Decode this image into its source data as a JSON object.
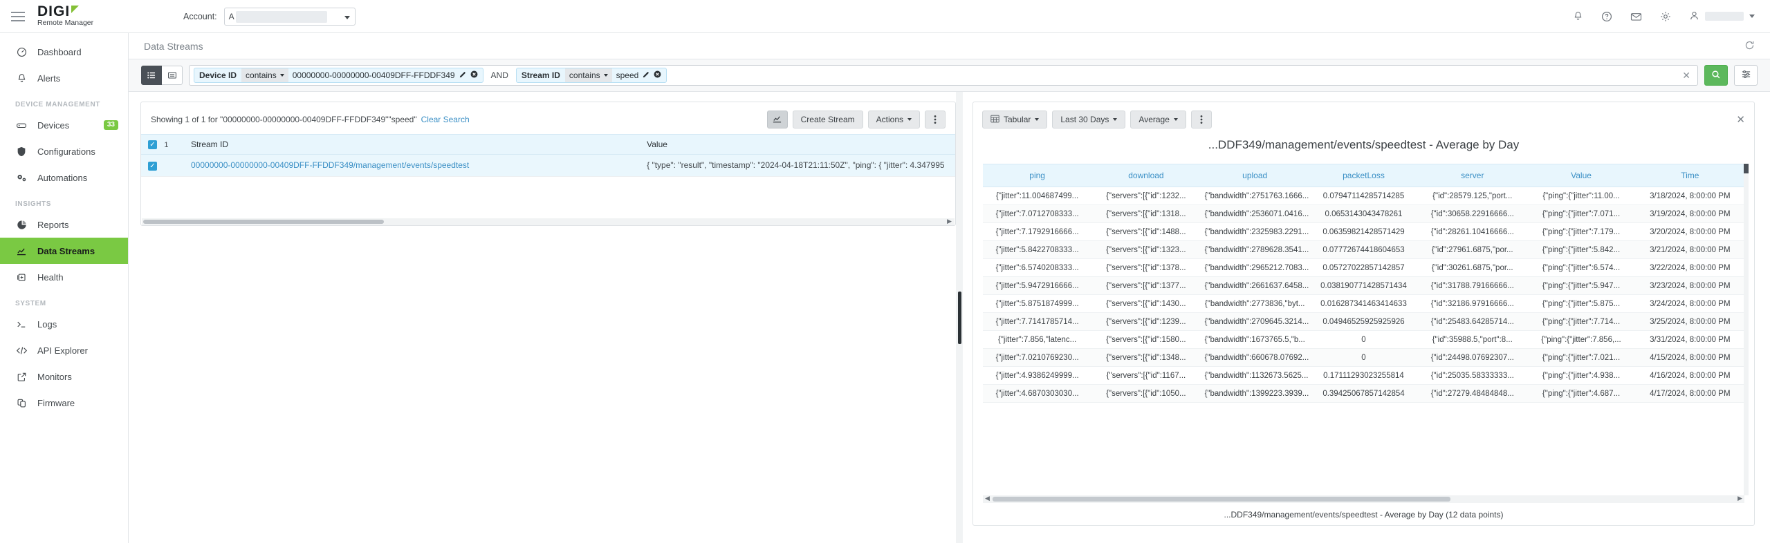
{
  "topbar": {
    "logo_text": "DIGI",
    "logo_sub": "Remote Manager",
    "account_label": "Account:",
    "account_value": "A",
    "menu_icon": "hamburger-icon",
    "icons": [
      "bell-icon",
      "help-icon",
      "mail-icon",
      "gear-icon",
      "user-icon"
    ]
  },
  "sidebar": {
    "items": [
      {
        "label": "Dashboard",
        "icon": "gauge-icon"
      },
      {
        "label": "Alerts",
        "icon": "bell-icon"
      }
    ],
    "section_device_management": "DEVICE MANAGEMENT",
    "device_items": [
      {
        "label": "Devices",
        "icon": "device-icon",
        "badge": "33"
      },
      {
        "label": "Configurations",
        "icon": "shield-icon",
        "badge": ""
      },
      {
        "label": "Automations",
        "icon": "gears-icon",
        "badge": ""
      }
    ],
    "section_insights": "INSIGHTS",
    "insight_items": [
      {
        "label": "Reports",
        "icon": "pie-chart-icon"
      },
      {
        "label": "Data Streams",
        "icon": "line-chart-icon"
      },
      {
        "label": "Health",
        "icon": "health-kit-icon"
      }
    ],
    "section_system": "SYSTEM",
    "system_items": [
      {
        "label": "Logs",
        "icon": "terminal-icon"
      },
      {
        "label": "API Explorer",
        "icon": "code-icon"
      },
      {
        "label": "Monitors",
        "icon": "external-link-icon"
      },
      {
        "label": "Firmware",
        "icon": "copy-icon"
      }
    ],
    "active_item": "Data Streams"
  },
  "page": {
    "title": "Data Streams",
    "refresh_icon": "refresh-icon"
  },
  "filter_bar": {
    "view_list_icon": "list-view-icon",
    "view_detail_icon": "detail-view-icon",
    "chip1": {
      "field": "Device ID",
      "operator": "contains",
      "value": "00000000-00000000-00409DFF-FFDDF349",
      "edit_icon": "pencil-icon",
      "remove_icon": "remove-circle-icon"
    },
    "conjunction": "AND",
    "chip2": {
      "field": "Stream ID",
      "operator": "contains",
      "value": "speed",
      "edit_icon": "pencil-icon",
      "remove_icon": "remove-circle-icon"
    },
    "clear_icon": "clear-x-icon",
    "search_icon": "search-icon",
    "options_icon": "sliders-icon"
  },
  "results": {
    "showing_text": "Showing 1 of 1  for \"00000000-00000000-00409DFF-FFDDF349\"\"speed\"",
    "clear_search": "Clear Search",
    "chart_toggle_icon": "line-chart-icon",
    "create_stream": "Create Stream",
    "actions": "Actions",
    "more_icon": "kebab-menu-icon",
    "columns": [
      "Stream ID",
      "Value"
    ],
    "selected_count": "1",
    "rows": [
      {
        "stream_id": "00000000-00000000-00409DFF-FFDDF349/management/events/speedtest",
        "value": "{ \"type\": \"result\", \"timestamp\": \"2024-04-18T21:11:50Z\", \"ping\": { \"jitter\": 4.347995"
      }
    ]
  },
  "chart_panel": {
    "view_mode": "Tabular",
    "view_mode_icon": "table-icon",
    "time_range": "Last 30 Days",
    "aggregate": "Average",
    "more_icon": "kebab-menu-icon",
    "close_icon": "close-icon",
    "title": "...DDF349/management/events/speedtest - Average by Day",
    "footer": "...DDF349/management/events/speedtest - Average by Day (12 data points)"
  },
  "chart_data": {
    "type": "table",
    "title": "...DDF349/management/events/speedtest - Average by Day",
    "columns": [
      "ping",
      "download",
      "upload",
      "packetLoss",
      "server",
      "Value",
      "Time"
    ],
    "rows": [
      [
        "{\"jitter\":11.004687499...",
        "{\"servers\":[{\"id\":1232...",
        "{\"bandwidth\":2751763.1666...",
        "0.07947114285714285",
        "{\"id\":28579.125,\"port...",
        "{\"ping\":{\"jitter\":11.00...",
        "3/18/2024, 8:00:00 PM"
      ],
      [
        "{\"jitter\":7.0712708333...",
        "{\"servers\":[{\"id\":1318...",
        "{\"bandwidth\":2536071.0416...",
        "0.0653143043478261",
        "{\"id\":30658.22916666...",
        "{\"ping\":{\"jitter\":7.071...",
        "3/19/2024, 8:00:00 PM"
      ],
      [
        "{\"jitter\":7.1792916666...",
        "{\"servers\":[{\"id\":1488...",
        "{\"bandwidth\":2325983.2291...",
        "0.06359821428571429",
        "{\"id\":28261.10416666...",
        "{\"ping\":{\"jitter\":7.179...",
        "3/20/2024, 8:00:00 PM"
      ],
      [
        "{\"jitter\":5.8422708333...",
        "{\"servers\":[{\"id\":1323...",
        "{\"bandwidth\":2789628.3541...",
        "0.07772674418604653",
        "{\"id\":27961.6875,\"por...",
        "{\"ping\":{\"jitter\":5.842...",
        "3/21/2024, 8:00:00 PM"
      ],
      [
        "{\"jitter\":6.5740208333...",
        "{\"servers\":[{\"id\":1378...",
        "{\"bandwidth\":2965212.7083...",
        "0.05727022857142857",
        "{\"id\":30261.6875,\"por...",
        "{\"ping\":{\"jitter\":6.574...",
        "3/22/2024, 8:00:00 PM"
      ],
      [
        "{\"jitter\":5.9472916666...",
        "{\"servers\":[{\"id\":1377...",
        "{\"bandwidth\":2661637.6458...",
        "0.038190771428571434",
        "{\"id\":31788.79166666...",
        "{\"ping\":{\"jitter\":5.947...",
        "3/23/2024, 8:00:00 PM"
      ],
      [
        "{\"jitter\":5.8751874999...",
        "{\"servers\":[{\"id\":1430...",
        "{\"bandwidth\":2773836,\"byt...",
        "0.016287341463414633",
        "{\"id\":32186.97916666...",
        "{\"ping\":{\"jitter\":5.875...",
        "3/24/2024, 8:00:00 PM"
      ],
      [
        "{\"jitter\":7.7141785714...",
        "{\"servers\":[{\"id\":1239...",
        "{\"bandwidth\":2709645.3214...",
        "0.04946525925925926",
        "{\"id\":25483.64285714...",
        "{\"ping\":{\"jitter\":7.714...",
        "3/25/2024, 8:00:00 PM"
      ],
      [
        "{\"jitter\":7.856,\"latenc...",
        "{\"servers\":[{\"id\":1580...",
        "{\"bandwidth\":1673765.5,\"b...",
        "0",
        "{\"id\":35988.5,\"port\":8...",
        "{\"ping\":{\"jitter\":7.856,...",
        "3/31/2024, 8:00:00 PM"
      ],
      [
        "{\"jitter\":7.0210769230...",
        "{\"servers\":[{\"id\":1348...",
        "{\"bandwidth\":660678.07692...",
        "0",
        "{\"id\":24498.07692307...",
        "{\"ping\":{\"jitter\":7.021...",
        "4/15/2024, 8:00:00 PM"
      ],
      [
        "{\"jitter\":4.9386249999...",
        "{\"servers\":[{\"id\":1167...",
        "{\"bandwidth\":1132673.5625...",
        "0.17111293023255814",
        "{\"id\":25035.58333333...",
        "{\"ping\":{\"jitter\":4.938...",
        "4/16/2024, 8:00:00 PM"
      ],
      [
        "{\"jitter\":4.6870303030...",
        "{\"servers\":[{\"id\":1050...",
        "{\"bandwidth\":1399223.3939...",
        "0.39425067857142854",
        "{\"id\":27279.48484848...",
        "{\"ping\":{\"jitter\":4.687...",
        "4/17/2024, 8:00:00 PM"
      ]
    ],
    "data_point_count": 12
  },
  "colors": {
    "accent_green": "#7ac943",
    "link_blue": "#3a8fc5",
    "chip_blue": "#e8f6fd",
    "search_green": "#5cb85c"
  }
}
